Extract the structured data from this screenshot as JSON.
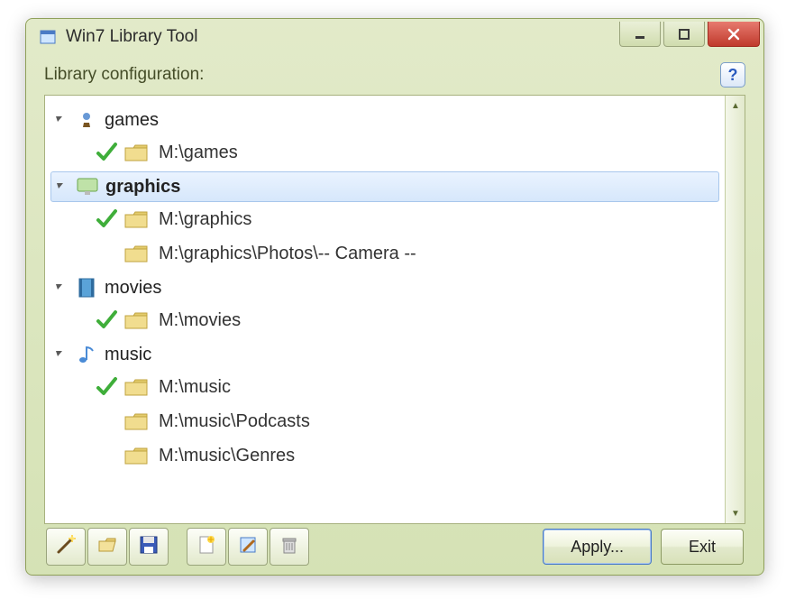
{
  "window": {
    "title": "Win7 Library Tool"
  },
  "section_label": "Library configuration:",
  "libraries": [
    {
      "name": "games",
      "icon": "chess",
      "selected": false,
      "bold": false,
      "folders": [
        {
          "path": "M:\\games",
          "checked": true
        }
      ]
    },
    {
      "name": "graphics",
      "icon": "monitor",
      "selected": true,
      "bold": true,
      "folders": [
        {
          "path": "M:\\graphics",
          "checked": true
        },
        {
          "path": "M:\\graphics\\Photos\\-- Camera --",
          "checked": false
        }
      ]
    },
    {
      "name": "movies",
      "icon": "film",
      "selected": false,
      "bold": false,
      "folders": [
        {
          "path": "M:\\movies",
          "checked": true
        }
      ]
    },
    {
      "name": "music",
      "icon": "note",
      "selected": false,
      "bold": false,
      "folders": [
        {
          "path": "M:\\music",
          "checked": true
        },
        {
          "path": "M:\\music\\Podcasts",
          "checked": false
        },
        {
          "path": "M:\\music\\Genres",
          "checked": false
        }
      ]
    }
  ],
  "buttons": {
    "apply": "Apply...",
    "exit": "Exit"
  },
  "toolbar_icons": [
    "wand",
    "open",
    "save",
    "new",
    "edit",
    "delete"
  ]
}
